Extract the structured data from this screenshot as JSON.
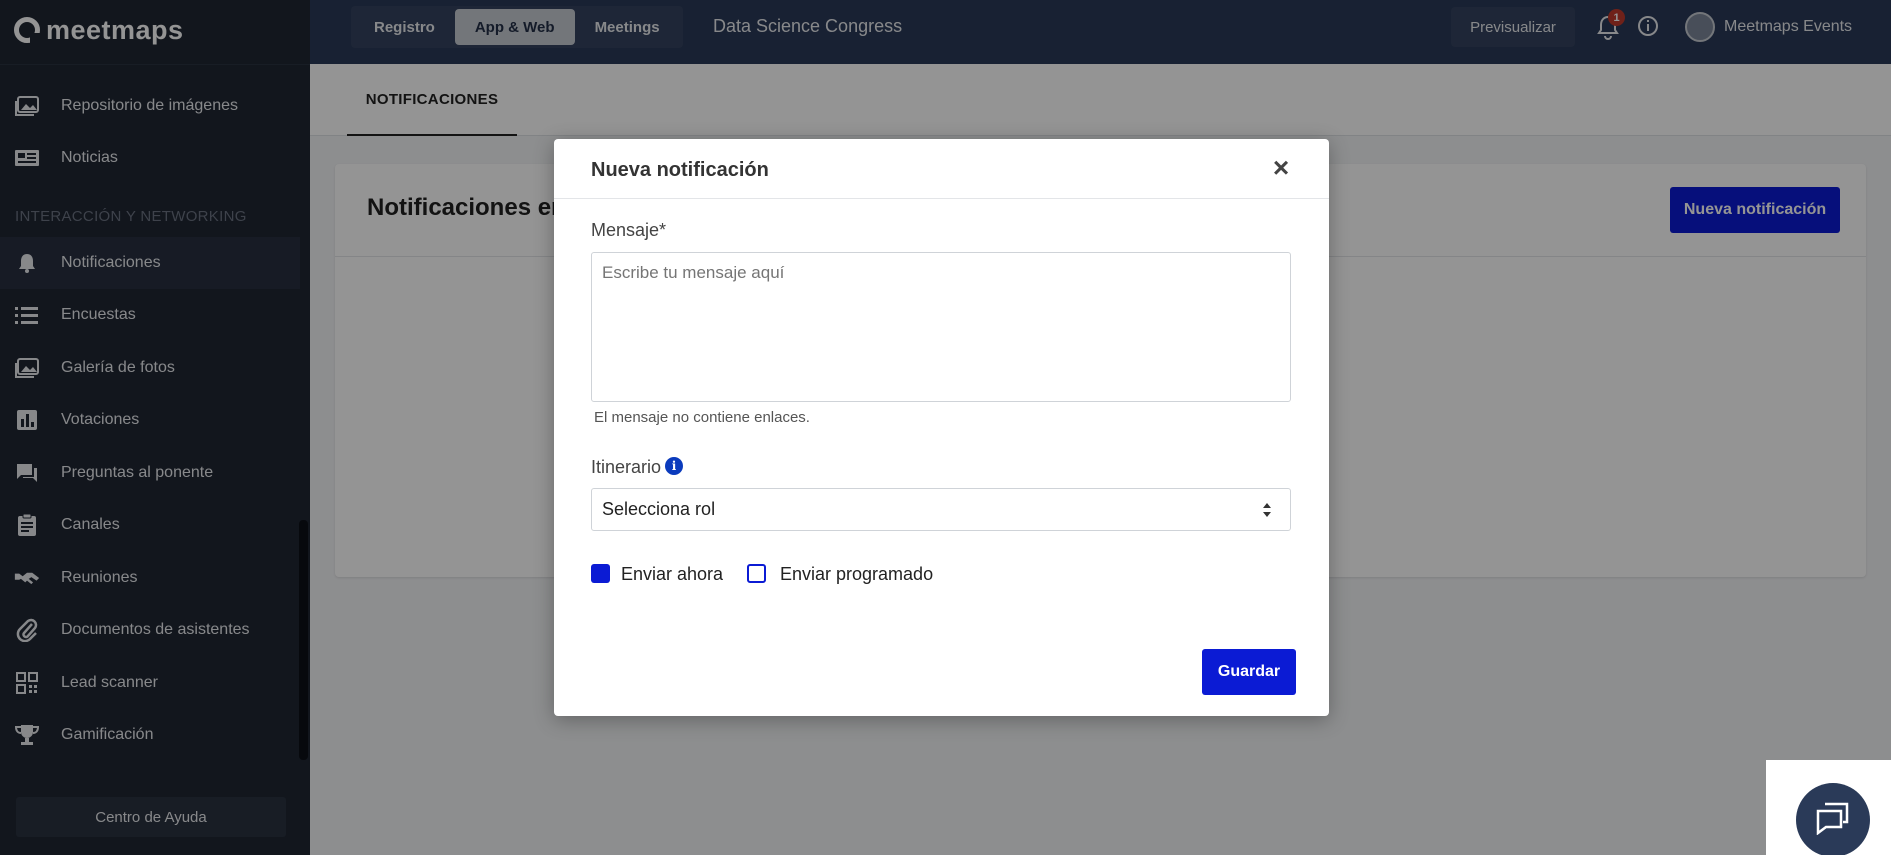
{
  "app": {
    "logo_text": "meetmaps"
  },
  "sidebar": {
    "items_top": [
      {
        "label": "Repositorio de imágenes",
        "icon": "image-gallery-icon"
      },
      {
        "label": "Noticias",
        "icon": "newspaper-icon"
      }
    ],
    "section_label": "INTERACCIÓN Y NETWORKING",
    "items": [
      {
        "label": "Notificaciones",
        "icon": "bell-icon",
        "active": true
      },
      {
        "label": "Encuestas",
        "icon": "list-icon"
      },
      {
        "label": "Galería de fotos",
        "icon": "photo-gallery-icon"
      },
      {
        "label": "Votaciones",
        "icon": "bar-chart-icon"
      },
      {
        "label": "Preguntas al ponente",
        "icon": "chat-bubbles-icon"
      },
      {
        "label": "Canales",
        "icon": "clipboard-icon"
      },
      {
        "label": "Reuniones",
        "icon": "handshake-icon"
      },
      {
        "label": "Documentos de asistentes",
        "icon": "paperclip-icon"
      },
      {
        "label": "Lead scanner",
        "icon": "qr-code-icon"
      },
      {
        "label": "Gamificación",
        "icon": "trophy-icon"
      }
    ],
    "help_label": "Centro de Ayuda"
  },
  "topbar": {
    "tabs": [
      {
        "label": "Registro",
        "selected": false
      },
      {
        "label": "App & Web",
        "selected": true
      },
      {
        "label": "Meetings",
        "selected": false
      }
    ],
    "event_title": "Data Science Congress",
    "preview_label": "Previsualizar",
    "notification_count": "1",
    "user_name": "Meetmaps Events"
  },
  "main": {
    "subtab_label": "NOTIFICACIONES",
    "card_title": "Notificaciones en",
    "new_button_label": "Nueva notificación"
  },
  "modal": {
    "title": "Nueva notificación",
    "close_symbol": "×",
    "message_label": "Mensaje*",
    "message_placeholder": "Escribe tu mensaje aquí",
    "message_hint": "El mensaje no contiene enlaces.",
    "itinerary_label": "Itinerario",
    "info_symbol": "i",
    "select_value": "Selecciona rol",
    "send_now_label": "Enviar ahora",
    "send_now_checked": true,
    "send_scheduled_label": "Enviar programado",
    "send_scheduled_checked": false,
    "save_label": "Guardar"
  },
  "colors": {
    "sidebar_bg": "#1f2633",
    "topbar_bg": "#2a3a58",
    "accent": "#0b1bd4",
    "badge": "#c0392b"
  }
}
